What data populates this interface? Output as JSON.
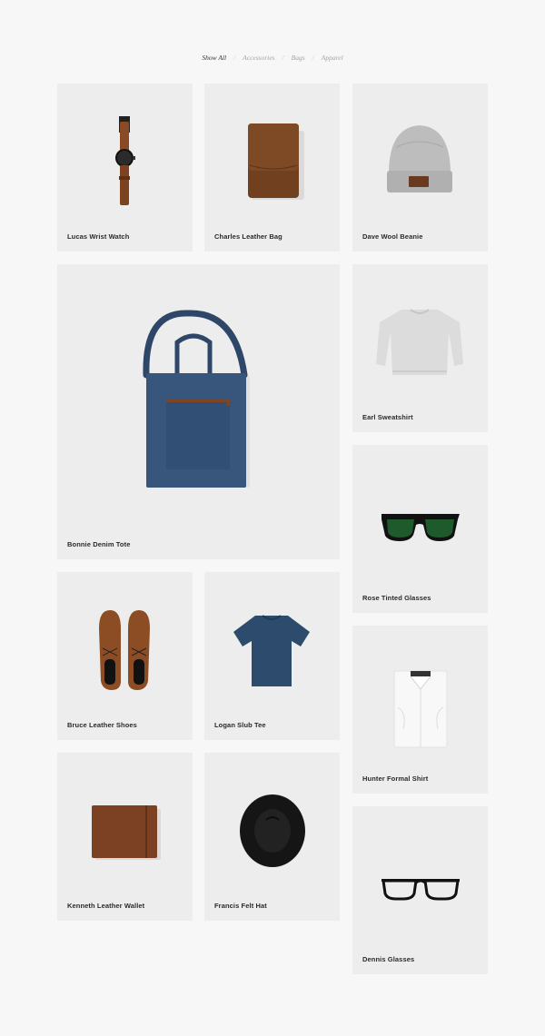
{
  "filters": {
    "items": [
      "Show All",
      "Accessories",
      "Bags",
      "Apparel"
    ],
    "separator": "/"
  },
  "products": {
    "watch": "Lucas Wrist Watch",
    "leather_bag": "Charles Leather Bag",
    "beanie": "Dave Wool Beanie",
    "tote": "Bonnie Denim Tote",
    "sweatshirt": "Earl Sweatshirt",
    "rose_glasses": "Rose Tinted Glasses",
    "shoes": "Bruce Leather Shoes",
    "tee": "Logan Slub Tee",
    "formal_shirt": "Hunter Formal Shirt",
    "wallet": "Kenneth Leather Wallet",
    "felt_hat": "Francis Felt Hat",
    "dennis_glasses": "Dennis Glasses"
  }
}
